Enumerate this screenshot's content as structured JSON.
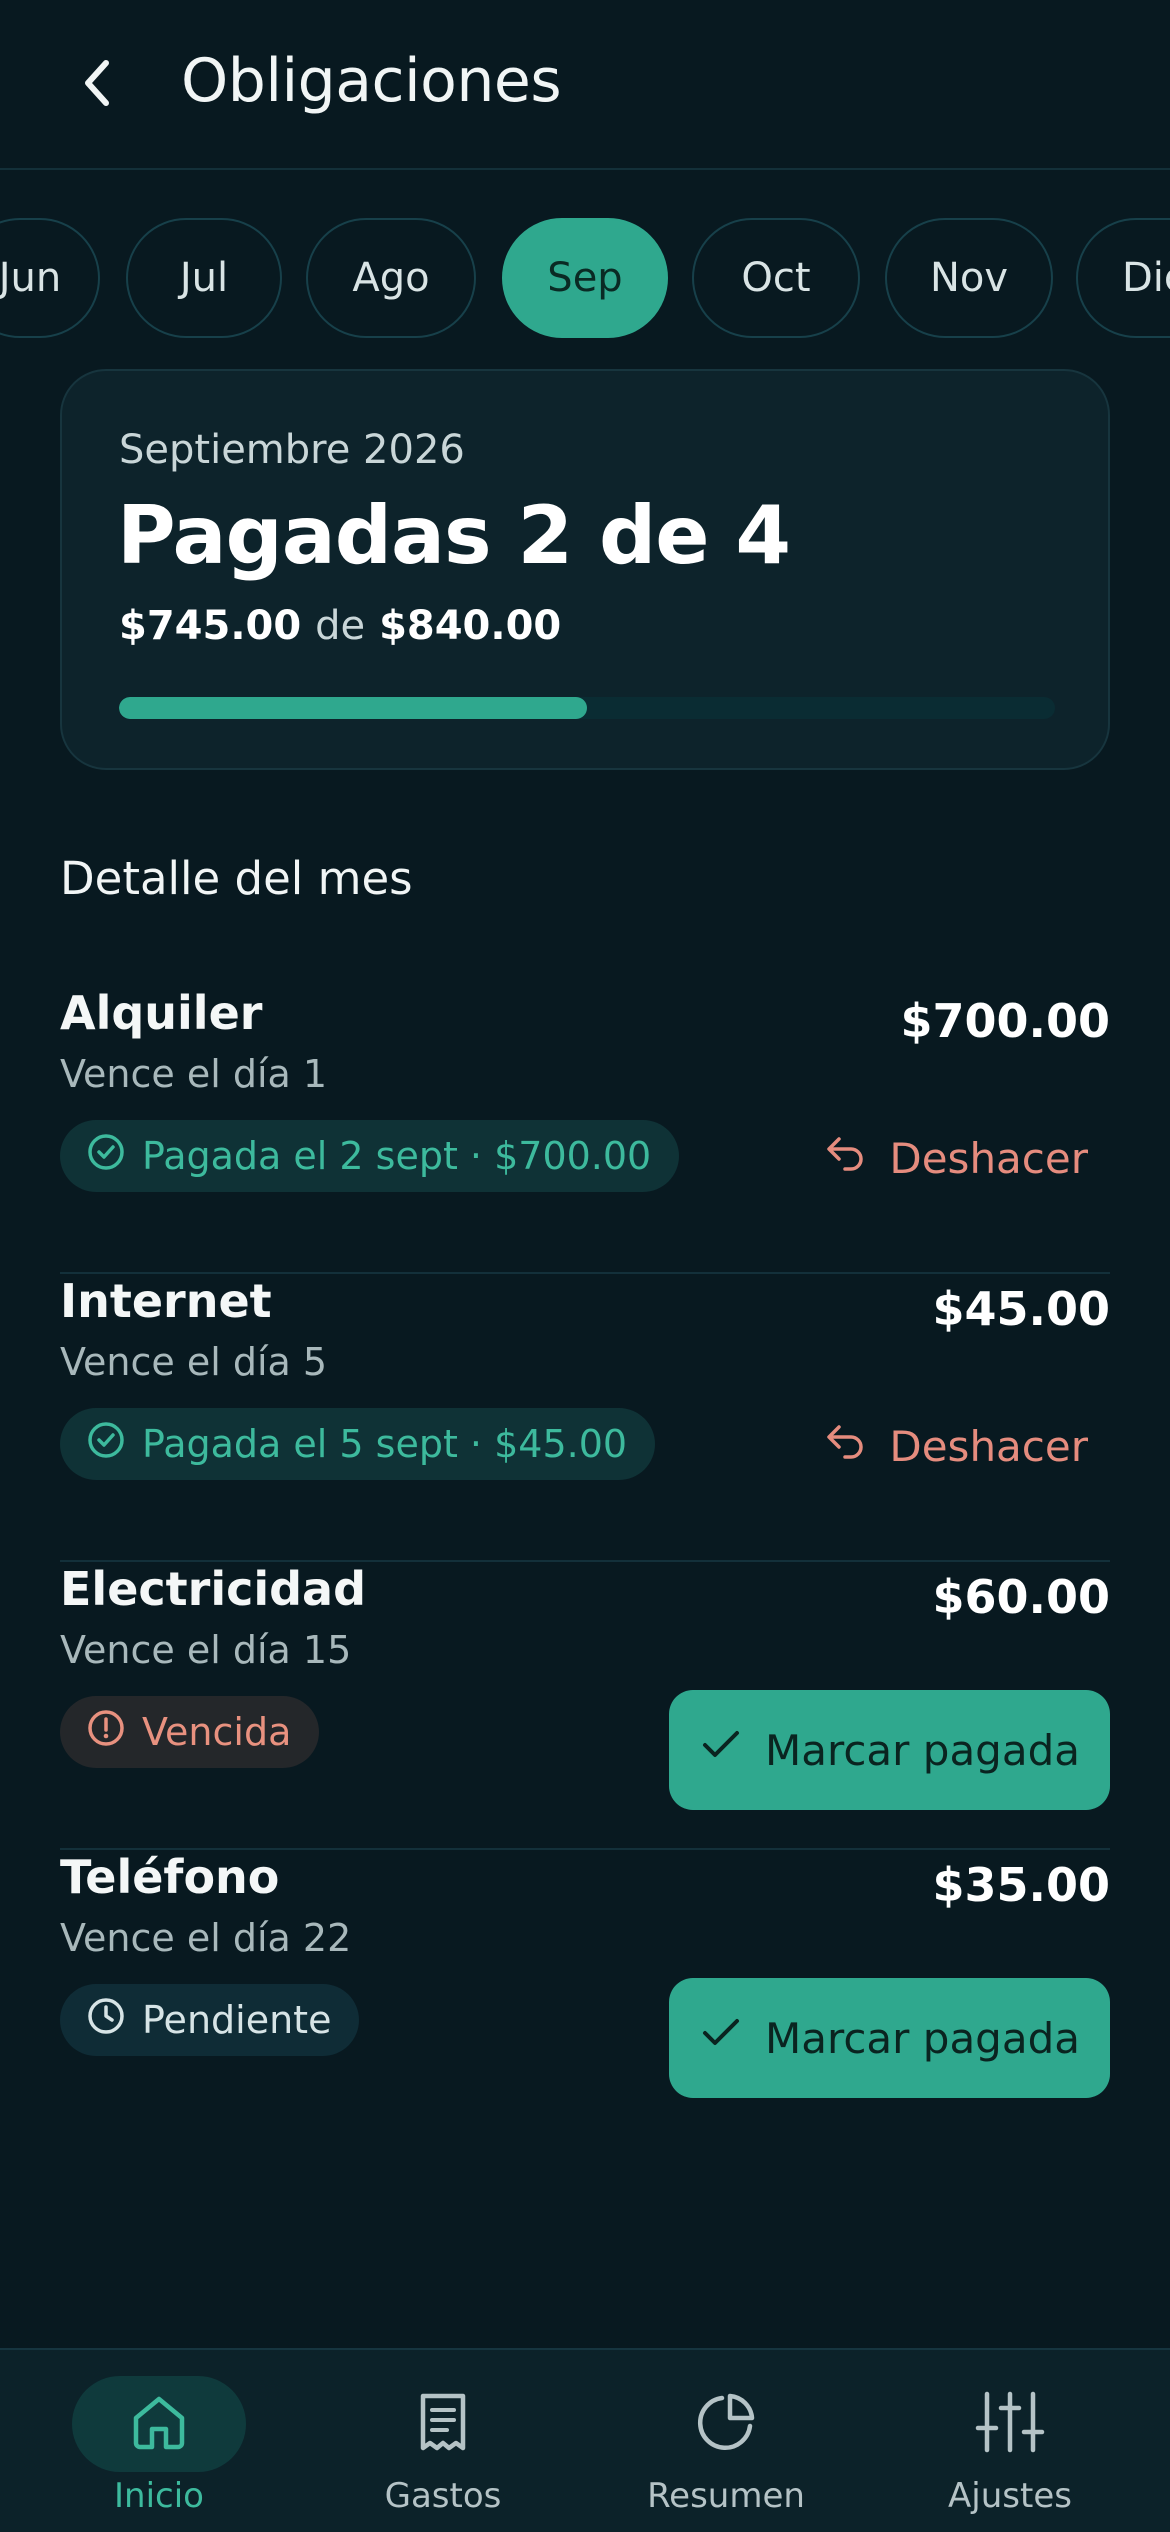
{
  "header": {
    "title": "Obligaciones",
    "back_icon": "chevron-left-icon"
  },
  "months": [
    "Jun",
    "Jul",
    "Ago",
    "Sep",
    "Oct",
    "Nov",
    "Dic"
  ],
  "selected_month": "Sep",
  "summary": {
    "month_label": "Septiembre 2026",
    "count_text": "Pagadas 2 de 4",
    "paid_amount": "$745.00",
    "connector": "de",
    "total_amount": "$840.00",
    "progress_fraction": 0.5
  },
  "section_title": "Detalle del mes",
  "obligations": [
    {
      "name": "Alquiler",
      "due": "Vence el día 1",
      "amount": "$700.00",
      "status": "paid",
      "badge": "Pagada el 2 sept · $700.00",
      "action": "Deshacer"
    },
    {
      "name": "Internet",
      "due": "Vence el día 5",
      "amount": "$45.00",
      "status": "paid",
      "badge": "Pagada el 5 sept · $45.00",
      "action": "Deshacer"
    },
    {
      "name": "Electricidad",
      "due": "Vence el día 15",
      "amount": "$60.00",
      "status": "overdue",
      "badge": "Vencida",
      "action": "Marcar pagada"
    },
    {
      "name": "Teléfono",
      "due": "Vence el día 22",
      "amount": "$35.00",
      "status": "pending",
      "badge": "Pendiente",
      "action": "Marcar pagada"
    }
  ],
  "nav": [
    {
      "label": "Inicio",
      "icon": "home-icon",
      "active": true
    },
    {
      "label": "Gastos",
      "icon": "receipt-icon",
      "active": false
    },
    {
      "label": "Resumen",
      "icon": "pie-chart-icon",
      "active": false
    },
    {
      "label": "Ajustes",
      "icon": "sliders-icon",
      "active": false
    }
  ],
  "colors": {
    "background": "#081920",
    "accent": "#2FA88E",
    "paid_text": "#3DBA9D",
    "undo_text": "#E58C7E",
    "overdue_text": "#E8917F"
  }
}
